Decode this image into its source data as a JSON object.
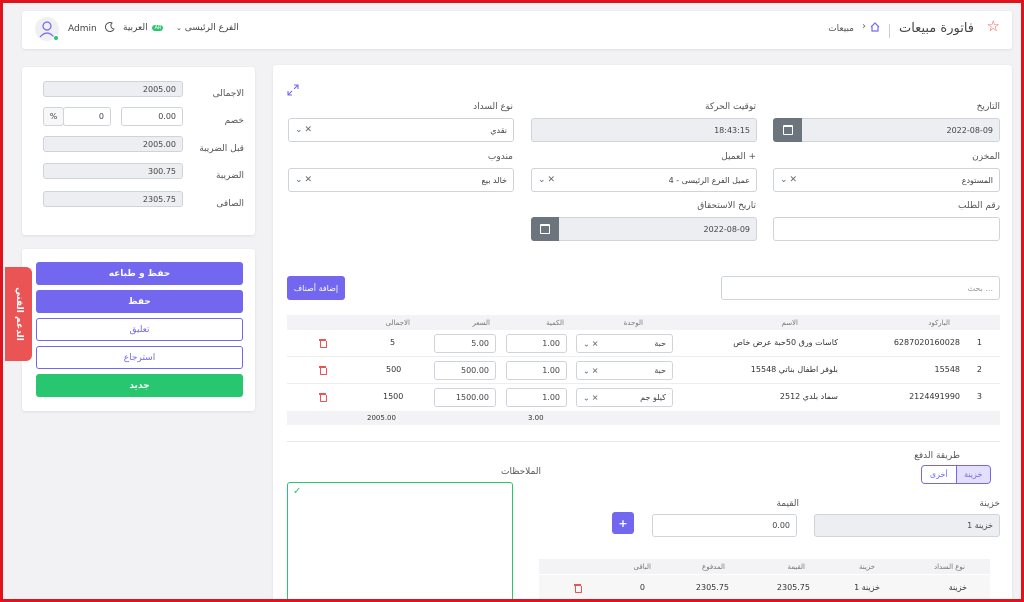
{
  "header": {
    "title": "فاتورة مبيعات",
    "breadcrumb": "مبيعات",
    "user": "Admin",
    "language": "العربية",
    "language_badge": "AR",
    "branch": "الفرع الرئيسى"
  },
  "form": {
    "date_label": "التاريخ",
    "date_value": "2022-08-09",
    "time_label": "توقيت الحركة",
    "time_value": "18:43:15",
    "payment_type_label": "نوع السداد",
    "payment_type_value": "نقدي",
    "store_label": "المخزن",
    "store_value": "المستودع",
    "client_label": "العميل +",
    "client_value": "4 - عميل الفرع الرئيسى",
    "rep_label": "مندوب",
    "rep_value": "خالد بيع",
    "order_no_label": "رقم الطلب",
    "order_no_value": "",
    "due_date_label": "تاريخ الاستحقاق",
    "due_date_value": "2022-08-09"
  },
  "search": {
    "placeholder": "بحث ..."
  },
  "add_items_label": "إضافة أصناف",
  "items_table": {
    "headers": [
      "الباركود",
      "الاسم",
      "الوحدة",
      "الكمية",
      "السعر",
      "الاجمالى"
    ],
    "rows": [
      {
        "index": "1",
        "barcode": "6287020160028",
        "name": "كاسات ورق 50حبة عرض خاص",
        "unit": "حبة",
        "qty": "1.00",
        "price": "5.00",
        "total": "5"
      },
      {
        "index": "2",
        "barcode": "15548",
        "name": "15548 بلوفر اطفال بناتي",
        "unit": "حبة",
        "qty": "1.00",
        "price": "500.00",
        "total": "500"
      },
      {
        "index": "3",
        "barcode": "2124491990",
        "name": "سماد بلدي 2512",
        "unit": "كيلو جم",
        "qty": "1.00",
        "price": "1500.00",
        "total": "1500"
      }
    ],
    "footer_qty": "3.00",
    "footer_total": "2005.00"
  },
  "payment": {
    "method_label": "طريقة الدفع",
    "tabs": [
      "خزينة",
      "أخرى"
    ],
    "treasury_label": "خزينة",
    "treasury_value": "خزينة 1",
    "amount_label": "القيمة",
    "amount_value": "0.00",
    "table_headers": [
      "نوع السداد",
      "خزينة",
      "القيمة",
      "المدفوع",
      "الباقى"
    ],
    "table_row": {
      "type": "خزينة",
      "treasury": "خزينة 1",
      "value": "2305.75",
      "paid": "2305.75",
      "remaining": "0"
    }
  },
  "notes_label": "الملاحظات",
  "summary": {
    "total_label": "الاجمالى",
    "total_value": "2005.00",
    "discount_label": "خصم",
    "discount_value": "0.00",
    "discount_amount": "0",
    "discount_unit": "%",
    "before_tax_label": "قبل الضريبة",
    "before_tax_value": "2005.00",
    "tax_label": "الضريبة",
    "tax_value": "300.75",
    "net_label": "الصافى",
    "net_value": "2305.75"
  },
  "actions": {
    "save_print": "حفظ و طباعه",
    "save": "حفظ",
    "suspend": "تعليق",
    "retrieve": "استرجاع",
    "new": "جديد"
  },
  "support_tab": "الدعم الفني",
  "colors": {
    "accent": "#7367f0",
    "success": "#28c76f",
    "danger": "#ea5455",
    "frame": "#e0131c"
  }
}
